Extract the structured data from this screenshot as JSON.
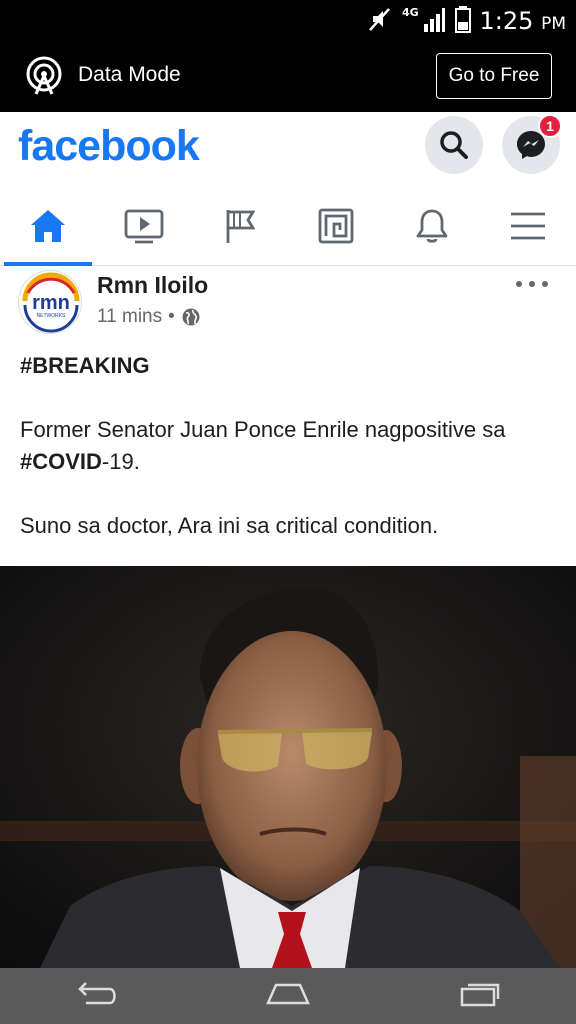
{
  "status_bar": {
    "time": "1:25",
    "ampm": "PM",
    "network": "4G"
  },
  "data_mode": {
    "label": "Data Mode",
    "button": "Go to Free"
  },
  "header": {
    "logo": "facebook",
    "messenger_badge": "1"
  },
  "nav_tabs": [
    {
      "name": "home",
      "icon": "home-icon",
      "active": true
    },
    {
      "name": "watch",
      "icon": "video-icon"
    },
    {
      "name": "pages",
      "icon": "flag-icon"
    },
    {
      "name": "gaming",
      "icon": "gaming-icon"
    },
    {
      "name": "notifications",
      "icon": "bell-icon"
    },
    {
      "name": "menu",
      "icon": "hamburger-icon"
    }
  ],
  "post": {
    "author": "Rmn Iloilo",
    "time": "11 mins",
    "separator": "•",
    "privacy_icon": "globe-icon",
    "avatar_text": "rmn",
    "avatar_subtext": "NETWORKS",
    "lines": {
      "hashtag_breaking": "#BREAKING",
      "line2_pre": " Former Senator Juan Ponce Enrile nagpositive sa ",
      "line2_tag": "#COVID",
      "line2_post": "-19.",
      "line3": " Suno sa doctor, Ara ini sa critical condition."
    }
  },
  "colors": {
    "brand": "#1877f2",
    "badge": "#e41e3f",
    "status_bg": "#000000"
  }
}
